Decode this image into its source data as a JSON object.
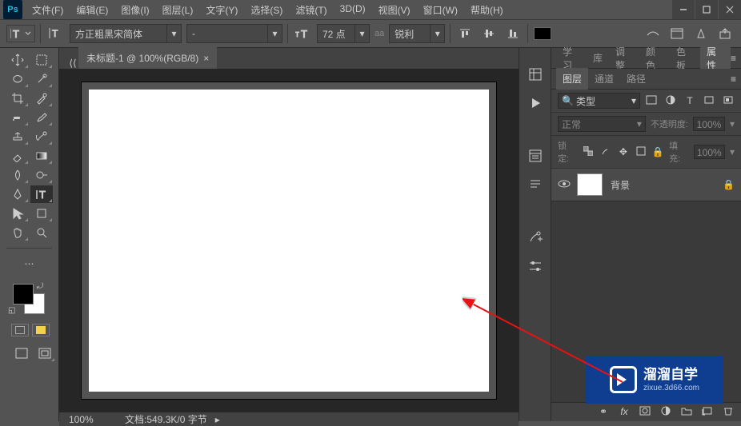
{
  "titlebar": {
    "logo": "Ps",
    "menus": [
      "文件(F)",
      "编辑(E)",
      "图像(I)",
      "图层(L)",
      "文字(Y)",
      "选择(S)",
      "滤镜(T)",
      "3D(D)",
      "视图(V)",
      "窗口(W)",
      "帮助(H)"
    ]
  },
  "options": {
    "font_family": "方正粗黑宋简体",
    "font_style": "-",
    "font_size": "72 点",
    "aa_label": "aa",
    "aa_mode": "锐利"
  },
  "document": {
    "tab_title": "未标题-1 @ 100%(RGB/8)",
    "zoom": "100%",
    "status": "文档:549.3K/0 字节"
  },
  "panels": {
    "group1": [
      "学习",
      "库",
      "调整",
      "颜色",
      "色板",
      "属性"
    ],
    "group2": [
      "图层",
      "通道",
      "路径"
    ],
    "layer_search_label": "类型",
    "blend_mode": "正常",
    "opacity_label": "不透明度:",
    "opacity_value": "100%",
    "lock_label": "锁定:",
    "fill_label": "填充:",
    "fill_value": "100%",
    "layer_name": "背景"
  },
  "watermark": {
    "title": "溜溜自学",
    "subtitle": "zixue.3d66.com"
  }
}
